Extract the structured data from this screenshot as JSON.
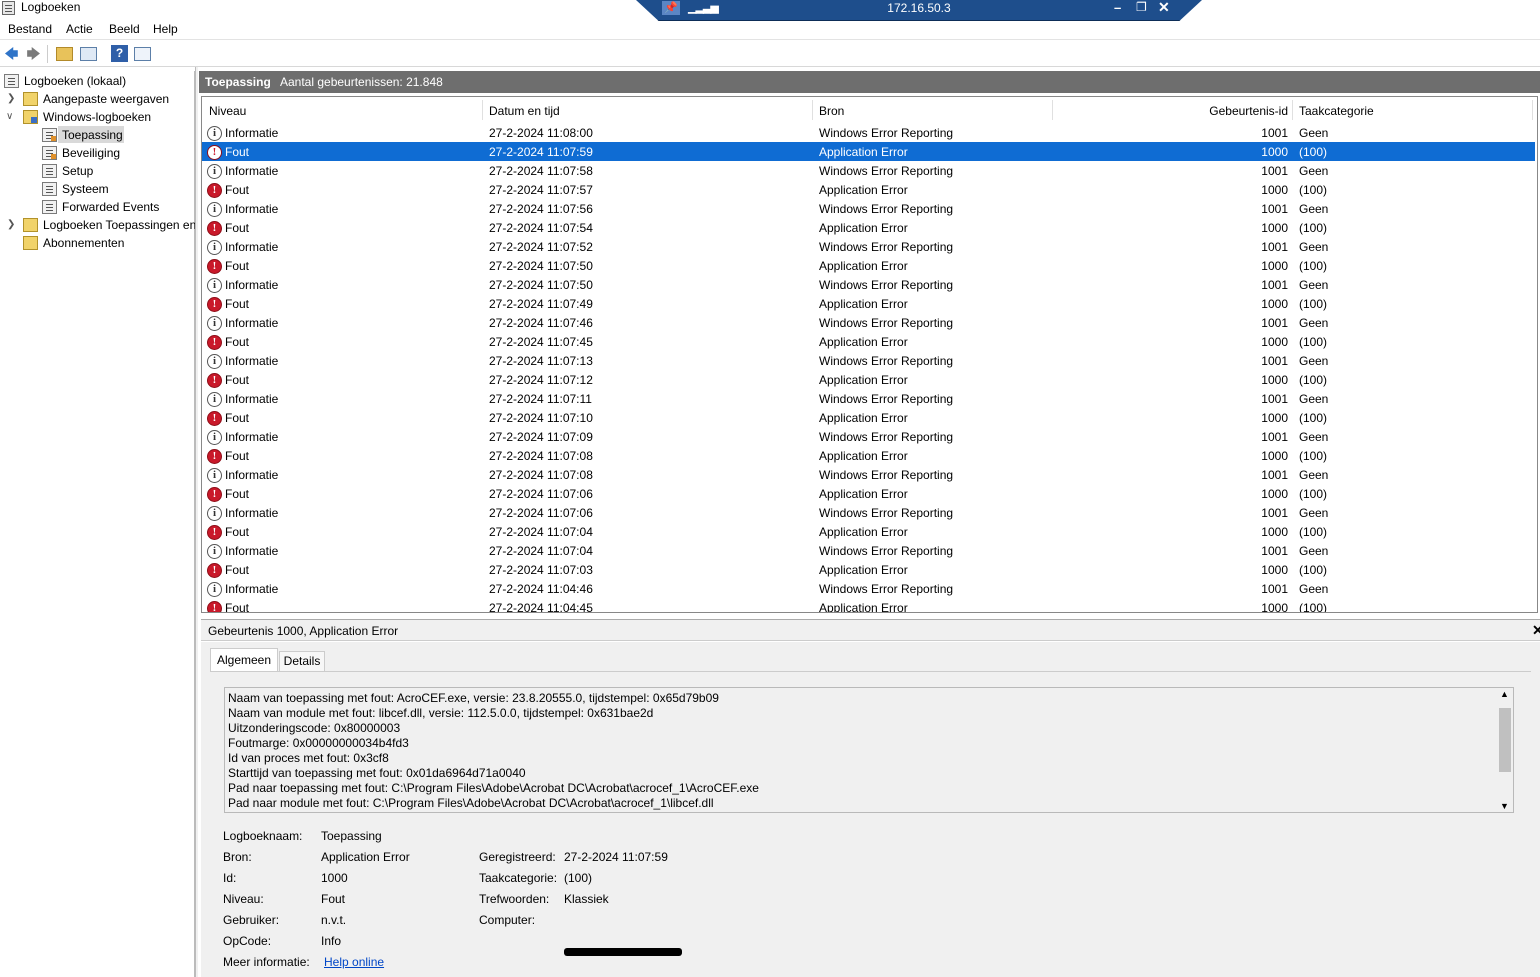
{
  "window": {
    "title": "Logboeken"
  },
  "rdp": {
    "pin_icon": "pin-icon",
    "signal_icon": "signal-icon",
    "ip": "172.16.50.3",
    "min": "–",
    "restore": "❐",
    "close": "✕"
  },
  "menu": [
    "Bestand",
    "Actie",
    "Beeld",
    "Help"
  ],
  "toolbar": {
    "back": "🡄",
    "forward": "🡆",
    "help": "?"
  },
  "tree": {
    "root": "Logboeken (lokaal)",
    "custom_views": "Aangepaste weergaven",
    "windows_logs": "Windows-logboeken",
    "application": "Toepassing",
    "security": "Beveiliging",
    "setup": "Setup",
    "system": "Systeem",
    "forwarded": "Forwarded Events",
    "app_services": "Logboeken Toepassingen en",
    "subscriptions": "Abonnementen"
  },
  "list": {
    "title": "Toepassing",
    "count": "Aantal gebeurtenissen: 21.848",
    "columns": {
      "level": "Niveau",
      "date": "Datum en tijd",
      "source": "Bron",
      "id": "Gebeurtenis-id",
      "category": "Taakcategorie"
    },
    "rows": [
      {
        "level": "Informatie",
        "date": "27-2-2024 11:08:00",
        "source": "Windows Error Reporting",
        "id": "1001",
        "category": "Geen"
      },
      {
        "level": "Fout",
        "date": "27-2-2024 11:07:59",
        "source": "Application Error",
        "id": "1000",
        "category": "(100)"
      },
      {
        "level": "Informatie",
        "date": "27-2-2024 11:07:58",
        "source": "Windows Error Reporting",
        "id": "1001",
        "category": "Geen"
      },
      {
        "level": "Fout",
        "date": "27-2-2024 11:07:57",
        "source": "Application Error",
        "id": "1000",
        "category": "(100)"
      },
      {
        "level": "Informatie",
        "date": "27-2-2024 11:07:56",
        "source": "Windows Error Reporting",
        "id": "1001",
        "category": "Geen"
      },
      {
        "level": "Fout",
        "date": "27-2-2024 11:07:54",
        "source": "Application Error",
        "id": "1000",
        "category": "(100)"
      },
      {
        "level": "Informatie",
        "date": "27-2-2024 11:07:52",
        "source": "Windows Error Reporting",
        "id": "1001",
        "category": "Geen"
      },
      {
        "level": "Fout",
        "date": "27-2-2024 11:07:50",
        "source": "Application Error",
        "id": "1000",
        "category": "(100)"
      },
      {
        "level": "Informatie",
        "date": "27-2-2024 11:07:50",
        "source": "Windows Error Reporting",
        "id": "1001",
        "category": "Geen"
      },
      {
        "level": "Fout",
        "date": "27-2-2024 11:07:49",
        "source": "Application Error",
        "id": "1000",
        "category": "(100)"
      },
      {
        "level": "Informatie",
        "date": "27-2-2024 11:07:46",
        "source": "Windows Error Reporting",
        "id": "1001",
        "category": "Geen"
      },
      {
        "level": "Fout",
        "date": "27-2-2024 11:07:45",
        "source": "Application Error",
        "id": "1000",
        "category": "(100)"
      },
      {
        "level": "Informatie",
        "date": "27-2-2024 11:07:13",
        "source": "Windows Error Reporting",
        "id": "1001",
        "category": "Geen"
      },
      {
        "level": "Fout",
        "date": "27-2-2024 11:07:12",
        "source": "Application Error",
        "id": "1000",
        "category": "(100)"
      },
      {
        "level": "Informatie",
        "date": "27-2-2024 11:07:11",
        "source": "Windows Error Reporting",
        "id": "1001",
        "category": "Geen"
      },
      {
        "level": "Fout",
        "date": "27-2-2024 11:07:10",
        "source": "Application Error",
        "id": "1000",
        "category": "(100)"
      },
      {
        "level": "Informatie",
        "date": "27-2-2024 11:07:09",
        "source": "Windows Error Reporting",
        "id": "1001",
        "category": "Geen"
      },
      {
        "level": "Fout",
        "date": "27-2-2024 11:07:08",
        "source": "Application Error",
        "id": "1000",
        "category": "(100)"
      },
      {
        "level": "Informatie",
        "date": "27-2-2024 11:07:08",
        "source": "Windows Error Reporting",
        "id": "1001",
        "category": "Geen"
      },
      {
        "level": "Fout",
        "date": "27-2-2024 11:07:06",
        "source": "Application Error",
        "id": "1000",
        "category": "(100)"
      },
      {
        "level": "Informatie",
        "date": "27-2-2024 11:07:06",
        "source": "Windows Error Reporting",
        "id": "1001",
        "category": "Geen"
      },
      {
        "level": "Fout",
        "date": "27-2-2024 11:07:04",
        "source": "Application Error",
        "id": "1000",
        "category": "(100)"
      },
      {
        "level": "Informatie",
        "date": "27-2-2024 11:07:04",
        "source": "Windows Error Reporting",
        "id": "1001",
        "category": "Geen"
      },
      {
        "level": "Fout",
        "date": "27-2-2024 11:07:03",
        "source": "Application Error",
        "id": "1000",
        "category": "(100)"
      },
      {
        "level": "Informatie",
        "date": "27-2-2024 11:04:46",
        "source": "Windows Error Reporting",
        "id": "1001",
        "category": "Geen"
      },
      {
        "level": "Fout",
        "date": "27-2-2024 11:04:45",
        "source": "Application Error",
        "id": "1000",
        "category": "(100)"
      }
    ]
  },
  "detail": {
    "title": "Gebeurtenis 1000, Application Error",
    "tabs": {
      "general": "Algemeen",
      "details": "Details"
    },
    "description": [
      "Naam van toepassing met fout: AcroCEF.exe, versie: 23.8.20555.0, tijdstempel: 0x65d79b09",
      "Naam van module met fout: libcef.dll, versie: 112.5.0.0, tijdstempel: 0x631bae2d",
      "Uitzonderingscode: 0x80000003",
      "Foutmarge: 0x00000000034b4fd3",
      "Id van proces met fout: 0x3cf8",
      "Starttijd van toepassing met fout: 0x01da6964d71a0040",
      "Pad naar toepassing met fout: C:\\Program Files\\Adobe\\Acrobat DC\\Acrobat\\acrocef_1\\AcroCEF.exe",
      "Pad naar module met fout: C:\\Program Files\\Adobe\\Acrobat DC\\Acrobat\\acrocef_1\\libcef.dll"
    ],
    "props": {
      "log_name_label": "Logboeknaam:",
      "log_name": "Toepassing",
      "source_label": "Bron:",
      "source": "Application Error",
      "id_label": "Id:",
      "id": "1000",
      "level_label": "Niveau:",
      "level": "Fout",
      "user_label": "Gebruiker:",
      "user": "n.v.t.",
      "opcode_label": "OpCode:",
      "opcode": "Info",
      "more_info_label": "Meer informatie:",
      "more_info": "Help online",
      "logged_label": "Geregistreerd:",
      "logged": "27-2-2024 11:07:59",
      "task_label": "Taakcategorie:",
      "task": "(100)",
      "keywords_label": "Trefwoorden:",
      "keywords": "Klassiek",
      "computer_label": "Computer:"
    }
  }
}
